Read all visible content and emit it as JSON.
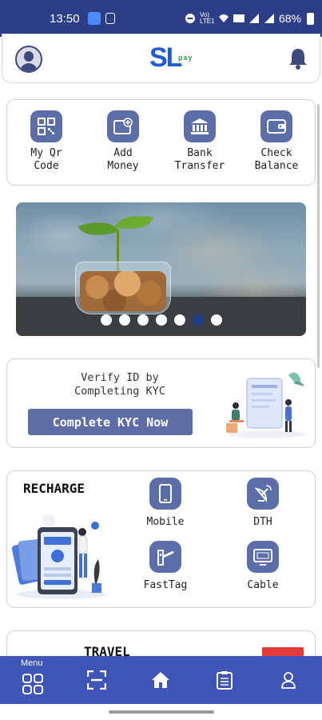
{
  "status_bar": {
    "time": "13:50",
    "network_label": "Vo) LTE1",
    "battery": "68%"
  },
  "header": {
    "logo_text": "SL",
    "logo_sub": "pay",
    "avatar_icon": "user-avatar-icon",
    "notification_icon": "bell-icon"
  },
  "quick_actions": [
    {
      "label": "My Qr\nCode",
      "icon": "qr-code-icon"
    },
    {
      "label": "Add\nMoney",
      "icon": "wallet-add-icon"
    },
    {
      "label": "Bank\nTransfer",
      "icon": "bank-icon"
    },
    {
      "label": "Check\nBalance",
      "icon": "wallet-icon"
    }
  ],
  "banner": {
    "slides": 7,
    "active_slide": 6
  },
  "kyc": {
    "text": "Verify ID by\nCompleting KYC",
    "button": "Complete KYC Now"
  },
  "recharge": {
    "title": "RECHARGE",
    "items": [
      {
        "label": "Mobile",
        "icon": "mobile-icon"
      },
      {
        "label": "DTH",
        "icon": "satellite-dish-icon"
      },
      {
        "label": "FastTag",
        "icon": "toll-gate-icon"
      },
      {
        "label": "Cable",
        "icon": "tv-icon"
      }
    ]
  },
  "travel": {
    "title": "TRAVEL"
  },
  "bottom_nav": {
    "menu_label": "Menu",
    "items": [
      "grid-menu-icon",
      "scan-icon",
      "home-icon",
      "clipboard-icon",
      "profile-icon"
    ]
  },
  "colors": {
    "primary": "#3e54b6",
    "icon_tile": "#5c6ea8",
    "status_bar": "#2c3e88",
    "logo_blue": "#1f5bd6",
    "logo_green": "#2e9b4d"
  }
}
